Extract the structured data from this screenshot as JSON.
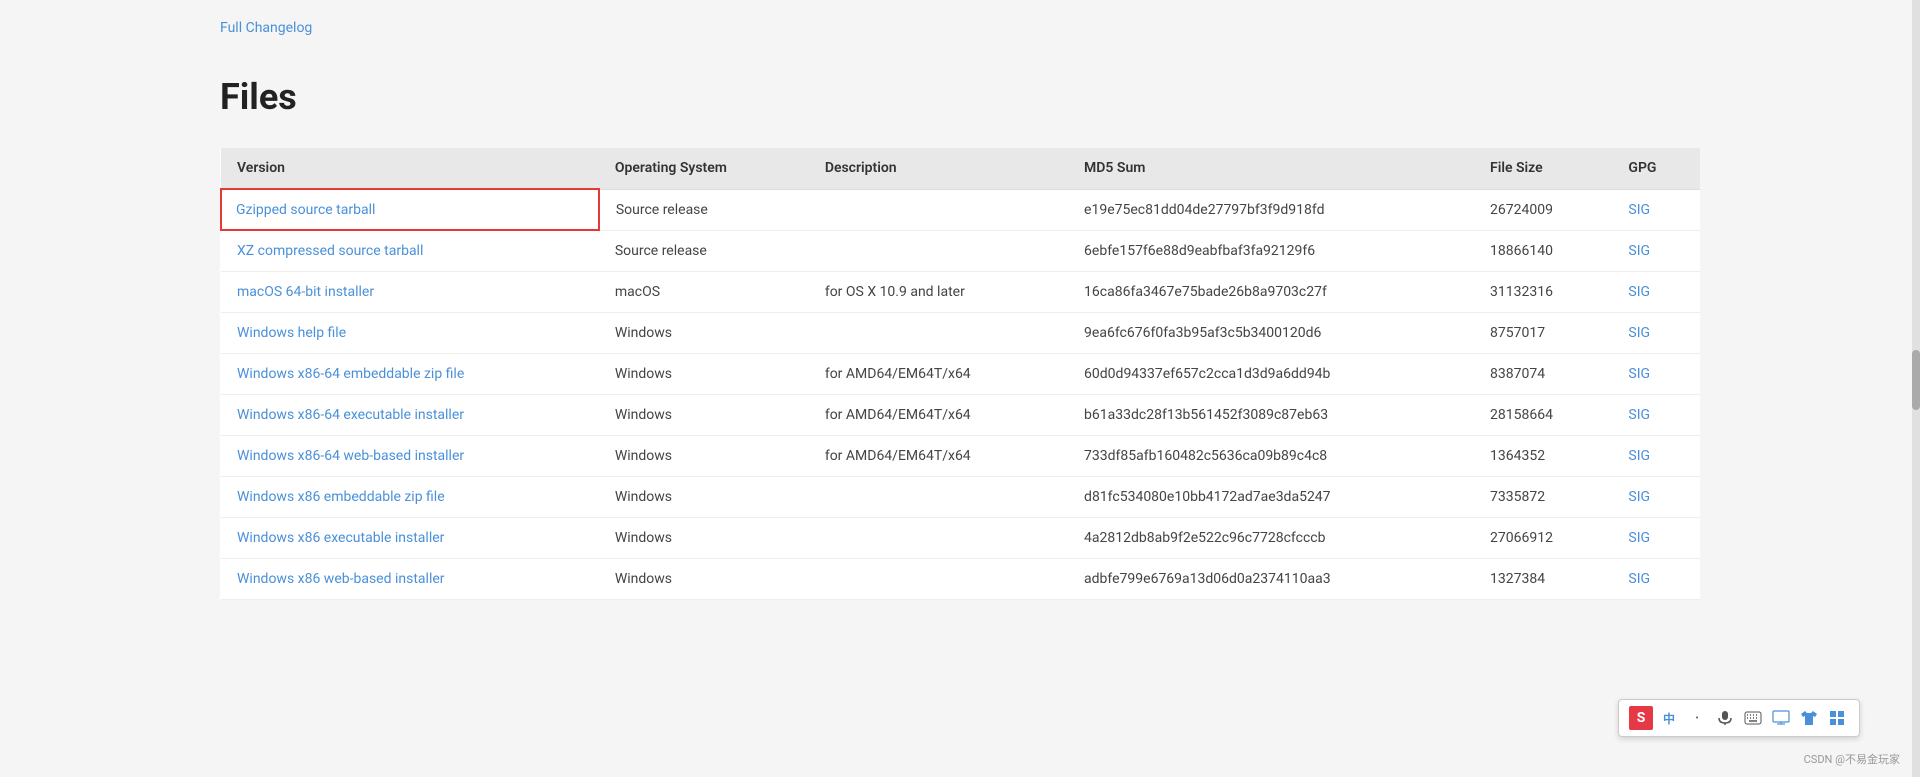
{
  "changelog": {
    "link_text": "Full Changelog"
  },
  "files_section": {
    "title": "Files",
    "table": {
      "headers": [
        "Version",
        "Operating System",
        "Description",
        "MD5 Sum",
        "File Size",
        "GPG"
      ],
      "rows": [
        {
          "version": "Gzipped source tarball",
          "os": "Source release",
          "description": "",
          "md5": "e19e75ec81dd04de27797bf3f9d918fd",
          "size": "26724009",
          "gpg": "SIG",
          "highlighted": true
        },
        {
          "version": "XZ compressed source tarball",
          "os": "Source release",
          "description": "",
          "md5": "6ebfe157f6e88d9eabfbaf3fa92129f6",
          "size": "18866140",
          "gpg": "SIG",
          "highlighted": false
        },
        {
          "version": "macOS 64-bit installer",
          "os": "macOS",
          "description": "for OS X 10.9 and later",
          "md5": "16ca86fa3467e75bade26b8a9703c27f",
          "size": "31132316",
          "gpg": "SIG",
          "highlighted": false
        },
        {
          "version": "Windows help file",
          "os": "Windows",
          "description": "",
          "md5": "9ea6fc676f0fa3b95af3c5b3400120d6",
          "size": "8757017",
          "gpg": "SIG",
          "highlighted": false
        },
        {
          "version": "Windows x86-64 embeddable zip file",
          "os": "Windows",
          "description": "for AMD64/EM64T/x64",
          "md5": "60d0d94337ef657c2cca1d3d9a6dd94b",
          "size": "8387074",
          "gpg": "SIG",
          "highlighted": false
        },
        {
          "version": "Windows x86-64 executable installer",
          "os": "Windows",
          "description": "for AMD64/EM64T/x64",
          "md5": "b61a33dc28f13b561452f3089c87eb63",
          "size": "28158664",
          "gpg": "SIG",
          "highlighted": false
        },
        {
          "version": "Windows x86-64 web-based installer",
          "os": "Windows",
          "description": "for AMD64/EM64T/x64",
          "md5": "733df85afb160482c5636ca09b89c4c8",
          "size": "1364352",
          "gpg": "SIG",
          "highlighted": false
        },
        {
          "version": "Windows x86 embeddable zip file",
          "os": "Windows",
          "description": "",
          "md5": "d81fc534080e10bb4172ad7ae3da5247",
          "size": "7335872",
          "gpg": "SIG",
          "highlighted": false
        },
        {
          "version": "Windows x86 executable installer",
          "os": "Windows",
          "description": "",
          "md5": "4a2812db8ab9f2e522c96c7728cfcccb",
          "size": "27066912",
          "gpg": "SIG",
          "highlighted": false
        },
        {
          "version": "Windows x86 web-based installer",
          "os": "Windows",
          "description": "",
          "md5": "adbfe799e6769a13d06d0a2374110aa3",
          "size": "1327384",
          "gpg": "SIG",
          "highlighted": false
        }
      ]
    }
  },
  "toolbar": {
    "icons": [
      "S",
      "中",
      "·•",
      "🎤",
      "⌨",
      "🖥",
      "👕",
      "⊞"
    ]
  },
  "watermark": "CSDN @不易金玩家"
}
